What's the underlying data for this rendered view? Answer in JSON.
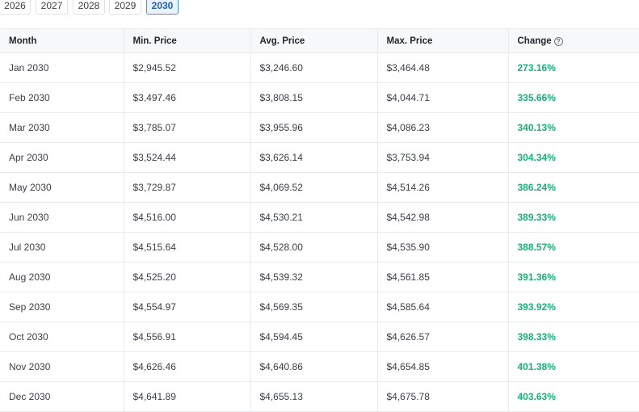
{
  "year_tabs": [
    {
      "label": "2026",
      "active": false
    },
    {
      "label": "2027",
      "active": false
    },
    {
      "label": "2028",
      "active": false
    },
    {
      "label": "2029",
      "active": false
    },
    {
      "label": "2030",
      "active": true
    }
  ],
  "table": {
    "headers": {
      "month": "Month",
      "min": "Min. Price",
      "avg": "Avg. Price",
      "max": "Max. Price",
      "change": "Change",
      "change_help_icon": "question-circle-icon"
    },
    "rows": [
      {
        "month": "Jan 2030",
        "min": "$2,945.52",
        "avg": "$3,246.60",
        "max": "$3,464.48",
        "change": "273.16%"
      },
      {
        "month": "Feb 2030",
        "min": "$3,497.46",
        "avg": "$3,808.15",
        "max": "$4,044.71",
        "change": "335.66%"
      },
      {
        "month": "Mar 2030",
        "min": "$3,785.07",
        "avg": "$3,955.96",
        "max": "$4,086.23",
        "change": "340.13%"
      },
      {
        "month": "Apr 2030",
        "min": "$3,524.44",
        "avg": "$3,626.14",
        "max": "$3,753.94",
        "change": "304.34%"
      },
      {
        "month": "May 2030",
        "min": "$3,729.87",
        "avg": "$4,069.52",
        "max": "$4,514.26",
        "change": "386.24%"
      },
      {
        "month": "Jun 2030",
        "min": "$4,516.00",
        "avg": "$4,530.21",
        "max": "$4,542.98",
        "change": "389.33%"
      },
      {
        "month": "Jul 2030",
        "min": "$4,515.64",
        "avg": "$4,528.00",
        "max": "$4,535.90",
        "change": "388.57%"
      },
      {
        "month": "Aug 2030",
        "min": "$4,525.20",
        "avg": "$4,539.32",
        "max": "$4,561.85",
        "change": "391.36%"
      },
      {
        "month": "Sep 2030",
        "min": "$4,554.97",
        "avg": "$4,569.35",
        "max": "$4,585.64",
        "change": "393.92%"
      },
      {
        "month": "Oct 2030",
        "min": "$4,556.91",
        "avg": "$4,594.45",
        "max": "$4,626.57",
        "change": "398.33%"
      },
      {
        "month": "Nov 2030",
        "min": "$4,626.46",
        "avg": "$4,640.86",
        "max": "$4,654.85",
        "change": "401.38%"
      },
      {
        "month": "Dec 2030",
        "min": "$4,641.89",
        "avg": "$4,655.13",
        "max": "$4,675.78",
        "change": "403.63%"
      }
    ]
  },
  "colors": {
    "change_positive": "#16b27a",
    "active_tab_border": "#4a8fe0"
  }
}
